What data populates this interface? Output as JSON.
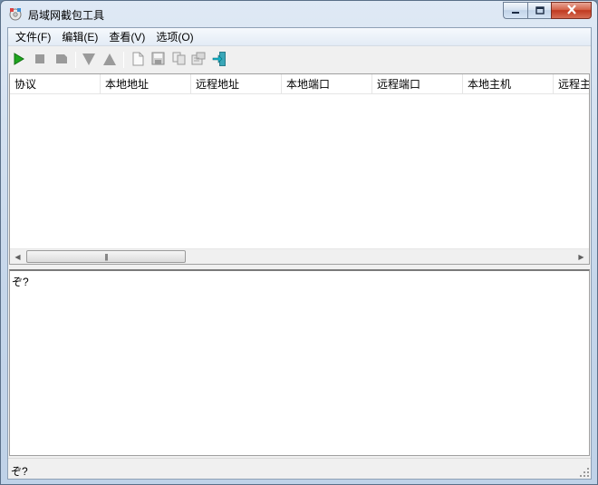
{
  "window": {
    "title": "局域网截包工具",
    "icon": "network-capture-icon",
    "controls": {
      "minimize": "minimize-icon",
      "maximize": "maximize-icon",
      "close": "close-icon"
    }
  },
  "menubar": {
    "items": [
      {
        "label": "文件(F)"
      },
      {
        "label": "编辑(E)"
      },
      {
        "label": "查看(V)"
      },
      {
        "label": "选项(O)"
      }
    ]
  },
  "toolbar": {
    "buttons": [
      {
        "icon": "play-icon",
        "enabled": true
      },
      {
        "icon": "stop-icon",
        "enabled": false
      },
      {
        "icon": "pause-icon",
        "enabled": false
      },
      {
        "icon": "triangle-down-icon",
        "enabled": false
      },
      {
        "icon": "triangle-up-icon",
        "enabled": false
      },
      {
        "icon": "new-document-icon",
        "enabled": false
      },
      {
        "icon": "save-icon",
        "enabled": false
      },
      {
        "icon": "copy-icon",
        "enabled": false
      },
      {
        "icon": "properties-icon",
        "enabled": false
      },
      {
        "icon": "exit-icon",
        "enabled": true
      }
    ]
  },
  "packet_list": {
    "columns": [
      "协议",
      "本地地址",
      "远程地址",
      "本地端口",
      "远程端口",
      "本地主机",
      "远程主"
    ],
    "rows": []
  },
  "detail_panel": {
    "text": "ぞ?"
  },
  "statusbar": {
    "text": "ぞ?"
  },
  "colors": {
    "play_green": "#1fa51f",
    "disabled_gray": "#9a9a9a",
    "exit_teal": "#1a8fa0"
  }
}
